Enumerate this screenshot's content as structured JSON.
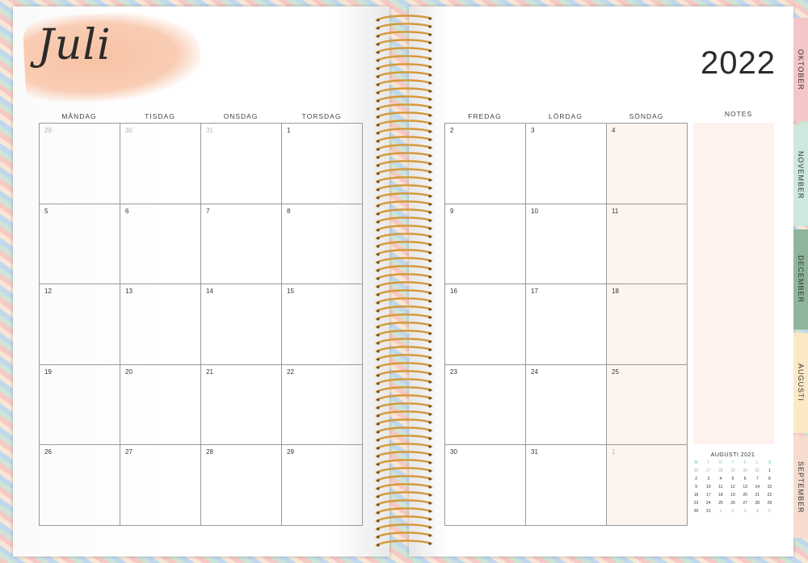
{
  "left_page": {
    "month_title": "Juli",
    "weekdays": [
      "MÅNDAG",
      "TISDAG",
      "ONSDAG",
      "TORSDAG"
    ],
    "weeks": [
      [
        {
          "d": "29",
          "other": true
        },
        {
          "d": "30",
          "other": true
        },
        {
          "d": "31",
          "other": true
        },
        {
          "d": "1"
        }
      ],
      [
        {
          "d": "5"
        },
        {
          "d": "6"
        },
        {
          "d": "7"
        },
        {
          "d": "8"
        }
      ],
      [
        {
          "d": "12"
        },
        {
          "d": "13"
        },
        {
          "d": "14"
        },
        {
          "d": "15"
        }
      ],
      [
        {
          "d": "19"
        },
        {
          "d": "20"
        },
        {
          "d": "21"
        },
        {
          "d": "22"
        }
      ],
      [
        {
          "d": "26"
        },
        {
          "d": "27"
        },
        {
          "d": "28"
        },
        {
          "d": "29"
        }
      ]
    ]
  },
  "right_page": {
    "year": "2022",
    "weekdays": [
      "FREDAG",
      "LÖRDAG",
      "SÖNDAG"
    ],
    "notes_label": "NOTES",
    "weeks": [
      [
        {
          "d": "2"
        },
        {
          "d": "3"
        },
        {
          "d": "4"
        }
      ],
      [
        {
          "d": "9"
        },
        {
          "d": "10"
        },
        {
          "d": "11"
        }
      ],
      [
        {
          "d": "16"
        },
        {
          "d": "17"
        },
        {
          "d": "18"
        }
      ],
      [
        {
          "d": "23"
        },
        {
          "d": "24"
        },
        {
          "d": "25"
        }
      ],
      [
        {
          "d": "30"
        },
        {
          "d": "31"
        },
        {
          "d": "1",
          "other": true
        }
      ]
    ],
    "mini_calendar": {
      "title": "AUGUSTI 2021",
      "dow": [
        "M",
        "T",
        "O",
        "T",
        "F",
        "L",
        "S"
      ],
      "rows": [
        [
          {
            "d": "26",
            "m": true
          },
          {
            "d": "27",
            "m": true
          },
          {
            "d": "28",
            "m": true
          },
          {
            "d": "29",
            "m": true
          },
          {
            "d": "30",
            "m": true
          },
          {
            "d": "31",
            "m": true
          },
          {
            "d": "1"
          }
        ],
        [
          {
            "d": "2"
          },
          {
            "d": "3"
          },
          {
            "d": "4"
          },
          {
            "d": "5"
          },
          {
            "d": "6"
          },
          {
            "d": "7"
          },
          {
            "d": "8"
          }
        ],
        [
          {
            "d": "9"
          },
          {
            "d": "10"
          },
          {
            "d": "11"
          },
          {
            "d": "12"
          },
          {
            "d": "13"
          },
          {
            "d": "14"
          },
          {
            "d": "15"
          }
        ],
        [
          {
            "d": "16"
          },
          {
            "d": "17"
          },
          {
            "d": "18"
          },
          {
            "d": "19"
          },
          {
            "d": "20"
          },
          {
            "d": "21"
          },
          {
            "d": "22"
          }
        ],
        [
          {
            "d": "23"
          },
          {
            "d": "24"
          },
          {
            "d": "25"
          },
          {
            "d": "26"
          },
          {
            "d": "27"
          },
          {
            "d": "28"
          },
          {
            "d": "29"
          }
        ],
        [
          {
            "d": "30"
          },
          {
            "d": "31"
          },
          {
            "d": "1",
            "m": true
          },
          {
            "d": "2",
            "m": true
          },
          {
            "d": "3",
            "m": true
          },
          {
            "d": "4",
            "m": true
          },
          {
            "d": "5",
            "m": true
          }
        ]
      ]
    }
  },
  "tabs": [
    {
      "label": "OKTOBER",
      "color": "#f4c6c8"
    },
    {
      "label": "NOVEMBER",
      "color": "#cde8dc"
    },
    {
      "label": "DECEMBER",
      "color": "#8fb59b"
    },
    {
      "label": "AUGUSTI",
      "color": "#fbe9c6"
    },
    {
      "label": "SEPTEMBER",
      "color": "#f6dcd0"
    }
  ],
  "colors": {
    "brush": "#f8c2a4",
    "spiral": "#d49a3c",
    "notes_bg": "#fff1ed"
  }
}
